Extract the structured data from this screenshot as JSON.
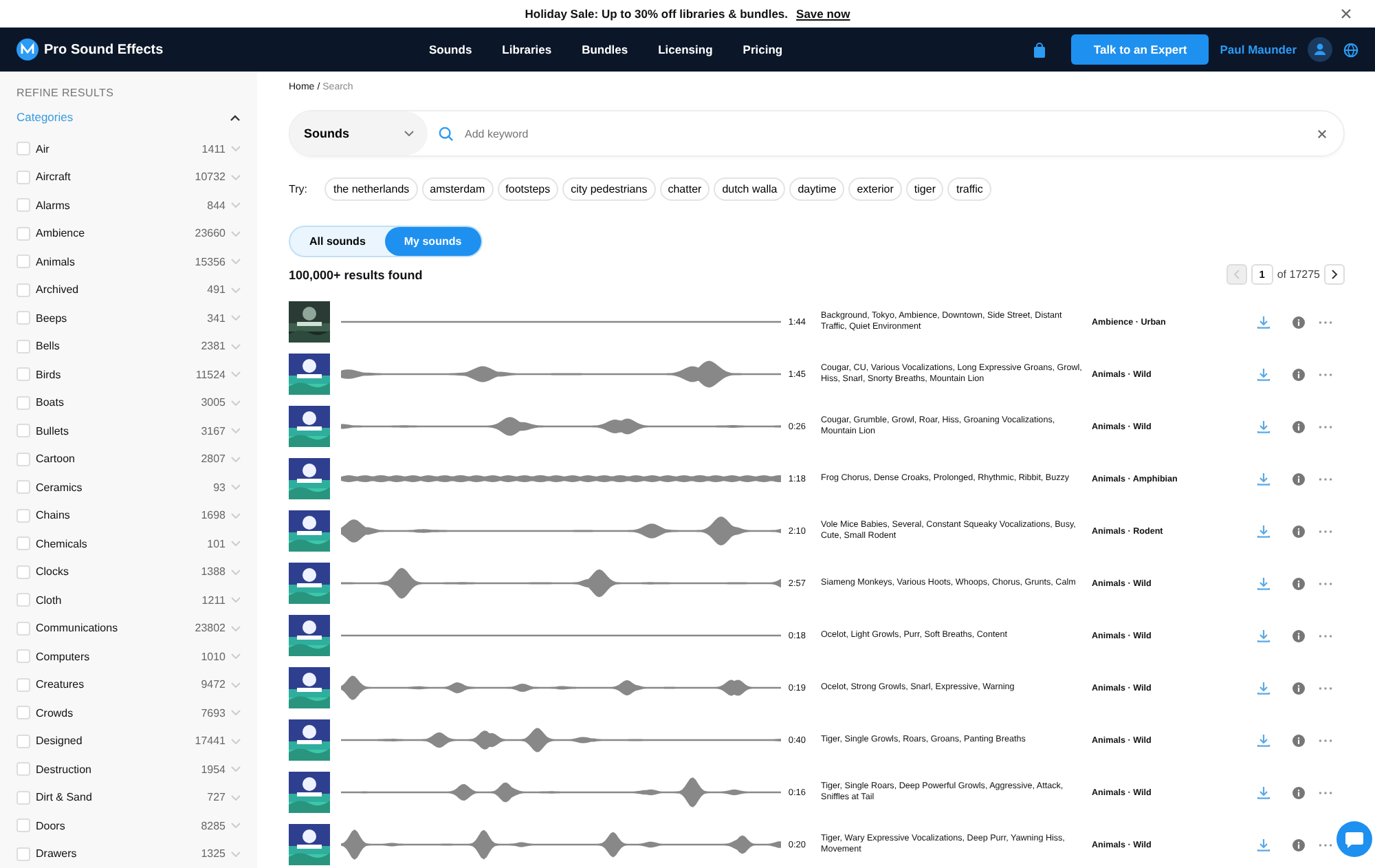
{
  "banner": {
    "text": "Holiday Sale: Up to 30% off libraries & bundles.",
    "link": "Save now"
  },
  "nav": {
    "brand": "Pro Sound Effects",
    "items": [
      "Sounds",
      "Libraries",
      "Bundles",
      "Licensing",
      "Pricing"
    ],
    "cta": "Talk to an Expert",
    "user": "Paul Maunder"
  },
  "sidebar": {
    "heading": "REFINE RESULTS",
    "section": "Categories",
    "expanded": true,
    "categories": [
      {
        "name": "Air",
        "count": "1411",
        "checked": false
      },
      {
        "name": "Aircraft",
        "count": "10732",
        "checked": false
      },
      {
        "name": "Alarms",
        "count": "844",
        "checked": false
      },
      {
        "name": "Ambience",
        "count": "23660",
        "checked": false
      },
      {
        "name": "Animals",
        "count": "15356",
        "checked": false
      },
      {
        "name": "Archived",
        "count": "491",
        "checked": false
      },
      {
        "name": "Beeps",
        "count": "341",
        "checked": false
      },
      {
        "name": "Bells",
        "count": "2381",
        "checked": false
      },
      {
        "name": "Birds",
        "count": "11524",
        "checked": false
      },
      {
        "name": "Boats",
        "count": "3005",
        "checked": false
      },
      {
        "name": "Bullets",
        "count": "3167",
        "checked": false
      },
      {
        "name": "Cartoon",
        "count": "2807",
        "checked": false
      },
      {
        "name": "Ceramics",
        "count": "93",
        "checked": false
      },
      {
        "name": "Chains",
        "count": "1698",
        "checked": false
      },
      {
        "name": "Chemicals",
        "count": "101",
        "checked": false
      },
      {
        "name": "Clocks",
        "count": "1388",
        "checked": false
      },
      {
        "name": "Cloth",
        "count": "1211",
        "checked": false
      },
      {
        "name": "Communications",
        "count": "23802",
        "checked": false
      },
      {
        "name": "Computers",
        "count": "1010",
        "checked": false
      },
      {
        "name": "Creatures",
        "count": "9472",
        "checked": false
      },
      {
        "name": "Crowds",
        "count": "7693",
        "checked": false
      },
      {
        "name": "Designed",
        "count": "17441",
        "checked": false
      },
      {
        "name": "Destruction",
        "count": "1954",
        "checked": false
      },
      {
        "name": "Dirt & Sand",
        "count": "727",
        "checked": false
      },
      {
        "name": "Doors",
        "count": "8285",
        "checked": false
      },
      {
        "name": "Drawers",
        "count": "1325",
        "checked": false
      }
    ]
  },
  "breadcrumb": [
    "Home",
    "Search"
  ],
  "breadcrumb_separator": "/",
  "search": {
    "type": "Sounds",
    "placeholder": "Add keyword"
  },
  "try": {
    "label": "Try:",
    "terms": [
      "the netherlands",
      "amsterdam",
      "footsteps",
      "city pedestrians",
      "chatter",
      "dutch walla",
      "daytime",
      "exterior",
      "tiger",
      "traffic"
    ]
  },
  "scope_tabs": [
    {
      "label": "All sounds",
      "selected": false
    },
    {
      "label": "My sounds",
      "selected": true
    }
  ],
  "results_count": "100,000+ results found",
  "pagination": {
    "page": "1",
    "total": "of 17275"
  },
  "results": [
    {
      "duration": "1:44",
      "description": "Background, Tokyo, Ambience, Downtown, Side Street, Distant Traffic, Quiet Environment",
      "category": "Ambience · Urban"
    },
    {
      "duration": "1:45",
      "description": "Cougar, CU, Various Vocalizations, Long Expressive Groans, Growl, Hiss, Snarl, Snorty Breaths, Mountain Lion",
      "category": "Animals · Wild"
    },
    {
      "duration": "0:26",
      "description": "Cougar, Grumble, Growl, Roar, Hiss, Groaning Vocalizations, Mountain Lion",
      "category": "Animals · Wild"
    },
    {
      "duration": "1:18",
      "description": "Frog Chorus, Dense Croaks, Prolonged, Rhythmic, Ribbit, Buzzy",
      "category": "Animals · Amphibian"
    },
    {
      "duration": "2:10",
      "description": "Vole Mice Babies, Several, Constant Squeaky Vocalizations, Busy, Cute, Small Rodent",
      "category": "Animals · Rodent"
    },
    {
      "duration": "2:57",
      "description": "Siameng Monkeys, Various Hoots, Whoops, Chorus, Grunts, Calm",
      "category": "Animals · Wild"
    },
    {
      "duration": "0:18",
      "description": "Ocelot, Light Growls, Purr, Soft Breaths, Content",
      "category": "Animals · Wild"
    },
    {
      "duration": "0:19",
      "description": "Ocelot, Strong Growls, Snarl, Expressive, Warning",
      "category": "Animals · Wild"
    },
    {
      "duration": "0:40",
      "description": "Tiger, Single Growls, Roars, Groans, Panting Breaths",
      "category": "Animals · Wild"
    },
    {
      "duration": "0:16",
      "description": "Tiger, Single Roars, Deep Powerful Growls, Aggressive, Attack, Sniffles at Tail",
      "category": "Animals · Wild"
    },
    {
      "duration": "0:20",
      "description": "Tiger, Wary Expressive Vocalizations, Deep Purr, Yawning Hiss, Movement",
      "category": "Animals · Wild"
    }
  ]
}
